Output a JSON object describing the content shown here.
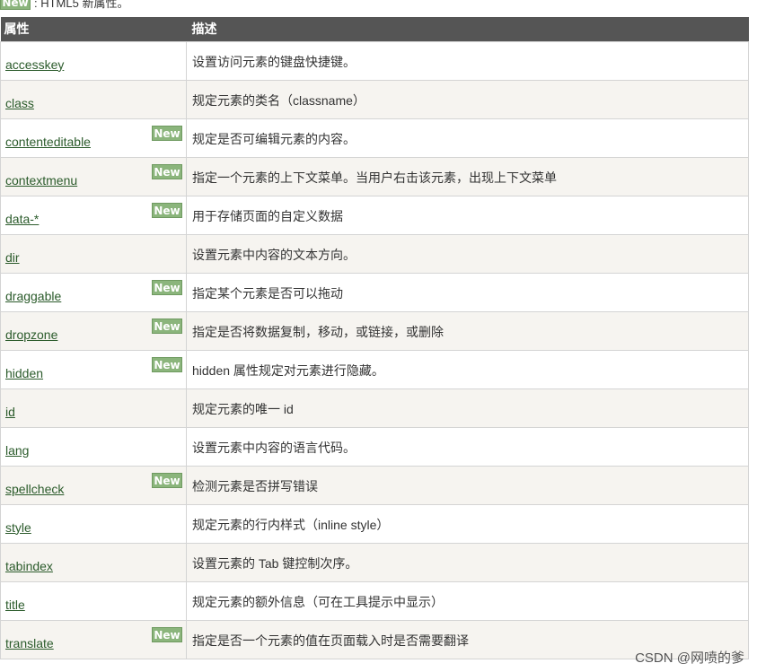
{
  "top_note": {
    "badge": "New",
    "text": ": HTML5 新属性。"
  },
  "table": {
    "headers": {
      "attribute": "属性",
      "description": "描述"
    },
    "rows": [
      {
        "name": "accesskey",
        "is_new": false,
        "badge": "",
        "desc": "设置访问元素的键盘快捷键。"
      },
      {
        "name": "class",
        "is_new": false,
        "badge": "",
        "desc": "规定元素的类名（classname）"
      },
      {
        "name": "contenteditable",
        "is_new": true,
        "badge": "New",
        "desc": "规定是否可编辑元素的内容。"
      },
      {
        "name": "contextmenu",
        "is_new": true,
        "badge": "New",
        "desc": "指定一个元素的上下文菜单。当用户右击该元素，出现上下文菜单"
      },
      {
        "name": "data-*",
        "is_new": true,
        "badge": "New",
        "desc": "用于存储页面的自定义数据"
      },
      {
        "name": "dir",
        "is_new": false,
        "badge": "",
        "desc": "设置元素中内容的文本方向。"
      },
      {
        "name": "draggable",
        "is_new": true,
        "badge": "New",
        "desc": "指定某个元素是否可以拖动"
      },
      {
        "name": "dropzone",
        "is_new": true,
        "badge": "New",
        "desc": "指定是否将数据复制，移动，或链接，或删除"
      },
      {
        "name": "hidden",
        "is_new": true,
        "badge": "New",
        "desc": "hidden 属性规定对元素进行隐藏。"
      },
      {
        "name": "id",
        "is_new": false,
        "badge": "",
        "desc": "规定元素的唯一 id"
      },
      {
        "name": "lang",
        "is_new": false,
        "badge": "",
        "desc": "设置元素中内容的语言代码。"
      },
      {
        "name": "spellcheck",
        "is_new": true,
        "badge": "New",
        "desc": "检测元素是否拼写错误"
      },
      {
        "name": "style",
        "is_new": false,
        "badge": "",
        "desc": "规定元素的行内样式（inline style）"
      },
      {
        "name": "tabindex",
        "is_new": false,
        "badge": "",
        "desc": "设置元素的 Tab 键控制次序。"
      },
      {
        "name": "title",
        "is_new": false,
        "badge": "",
        "desc": "规定元素的额外信息（可在工具提示中显示）"
      },
      {
        "name": "translate",
        "is_new": true,
        "badge": "New",
        "desc": "指定是否一个元素的值在页面载入时是否需要翻译"
      }
    ]
  },
  "watermark": "CSDN @网喷的爹"
}
